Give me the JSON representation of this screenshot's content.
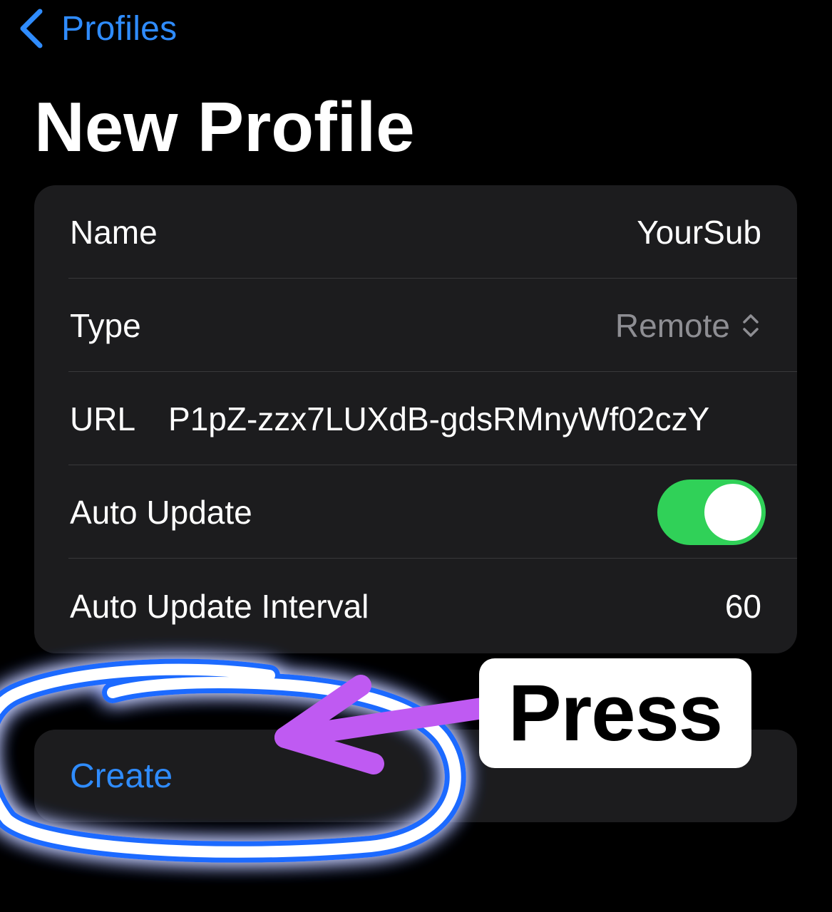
{
  "nav": {
    "back_label": "Profiles",
    "back_icon": "chevron-left-icon"
  },
  "page": {
    "title": "New Profile"
  },
  "form": {
    "name_label": "Name",
    "name_value": "YourSub",
    "type_label": "Type",
    "type_value": "Remote",
    "type_icon": "up-down-chevron-icon",
    "url_label": "URL",
    "url_value": "P1pZ-zzx7LUXdB-gdsRMnyWf02czY",
    "auto_update_label": "Auto Update",
    "auto_update_on": true,
    "interval_label": "Auto Update Interval",
    "interval_value": "60"
  },
  "actions": {
    "create_label": "Create"
  },
  "annotation": {
    "callout_text": "Press"
  },
  "colors": {
    "background": "#000000",
    "card": "#1c1c1e",
    "accent": "#2f8cff",
    "toggle_on": "#30d158",
    "annotation_arrow": "#bf5af2",
    "annotation_glow": "#1e6bff"
  }
}
